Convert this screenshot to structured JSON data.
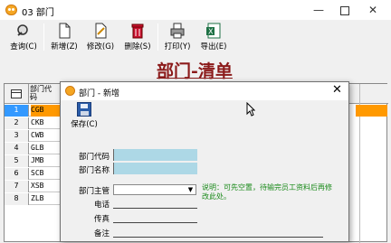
{
  "window": {
    "title": "03 部门"
  },
  "toolbar": {
    "query": "查询(C)",
    "add": "新增(Z)",
    "modify": "修改(G)",
    "delete": "删除(S)",
    "print": "打印(Y)",
    "export": "导出(E)"
  },
  "report": {
    "title": "部门-清单"
  },
  "grid": {
    "header": "部门代码",
    "rows": [
      {
        "num": "1",
        "code": "CGB"
      },
      {
        "num": "2",
        "code": "CKB"
      },
      {
        "num": "3",
        "code": "CWB"
      },
      {
        "num": "4",
        "code": "GLB"
      },
      {
        "num": "5",
        "code": "JMB"
      },
      {
        "num": "6",
        "code": "SCB"
      },
      {
        "num": "7",
        "code": "XSB"
      },
      {
        "num": "8",
        "code": "ZLB"
      }
    ],
    "selected_row": 1
  },
  "dialog": {
    "title": "部门 - 新增",
    "save": "保存(C)",
    "labels": {
      "code": "部门代码",
      "name": "部门名称",
      "manager": "部门主管",
      "phone": "电话",
      "fax": "传真",
      "remark": "备注"
    },
    "note": "说明：可先空置，待输完员工资料后再修改此处。"
  },
  "colors": {
    "required_field": "#add8e6",
    "selected_row": "#ff9900",
    "title_red": "#8b1a1a",
    "note_green": "#1a8a1a"
  }
}
